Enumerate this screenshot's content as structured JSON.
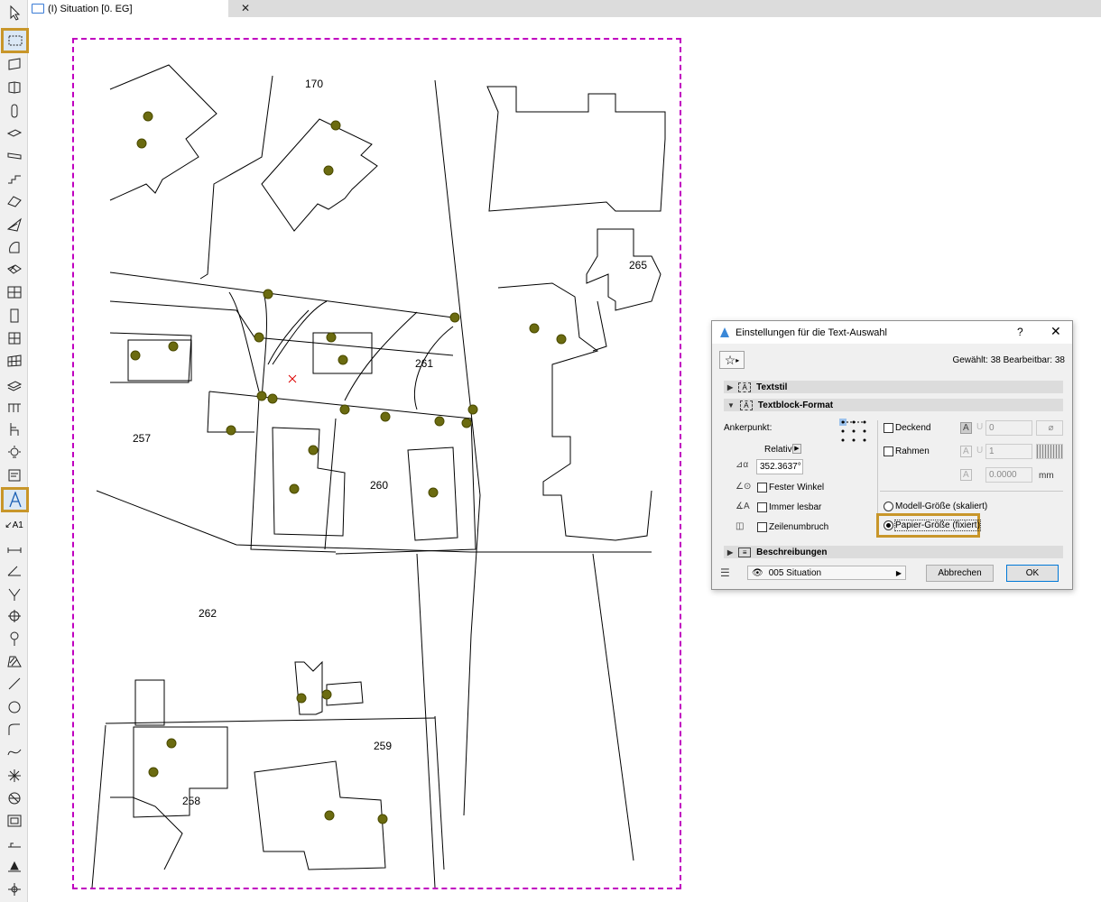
{
  "tab": {
    "title": "(I) Situation [0. EG]",
    "close": "✕"
  },
  "toolbox": {
    "tools": [
      "arrow-tool",
      "marquee-tool",
      "wall-tool",
      "curtain-wall-tool",
      "column-tool",
      "beam-tool",
      "slab-tool",
      "stair-tool",
      "roof-tool",
      "shell-tool",
      "morph-tool",
      "mesh-tool",
      "window-tool",
      "door-tool",
      "skylight-tool",
      "curtain-tool",
      "railing-tool",
      "chair-tool",
      "lamp-tool",
      "zone-tool",
      "text-tool",
      "label-tool",
      "dimension-tool",
      "angle-dimension-tool",
      "radial-dimension-tool",
      "level-dimension-tool",
      "section-marker-tool",
      "fill-tool",
      "line-tool",
      "circle-tool",
      "polyline-tool",
      "spline-tool",
      "hotspot-tool",
      "figure-tool",
      "drawing-tool",
      "elevation-tool",
      "marker-tool"
    ],
    "label_tool_text": "A1"
  },
  "plan": {
    "labels": [
      {
        "text": "170"
      },
      {
        "text": "265"
      },
      {
        "text": "261"
      },
      {
        "text": "257"
      },
      {
        "text": "260"
      },
      {
        "text": "262"
      },
      {
        "text": "259"
      },
      {
        "text": "258"
      }
    ]
  },
  "dialog": {
    "title": "Einstellungen für die Text-Auswahl",
    "help": "?",
    "close": "✕",
    "selection_info": "Gewählt: 38 Bearbeitbar: 38",
    "sections": {
      "textstil": "Textstil",
      "textblock": "Textblock-Format",
      "beschreibungen": "Beschreibungen"
    },
    "anchor_label": "Ankerpunkt:",
    "relative_label": "Relativ",
    "angle_value": "352.3637°",
    "checks": {
      "fixed_angle": "Fester Winkel",
      "always_readable": "Immer lesbar",
      "wrap": "Zeilenumbruch",
      "opaque": "Deckend",
      "frame": "Rahmen"
    },
    "opaque_value": "0",
    "frame_value": "1",
    "offset_value": "0.0000",
    "unit": "mm",
    "radios": {
      "model": "Modell-Größe (skaliert)",
      "paper": "Papier-Größe (fixiert)"
    },
    "layer": "005 Situation",
    "cancel": "Abbrechen",
    "ok": "OK"
  }
}
